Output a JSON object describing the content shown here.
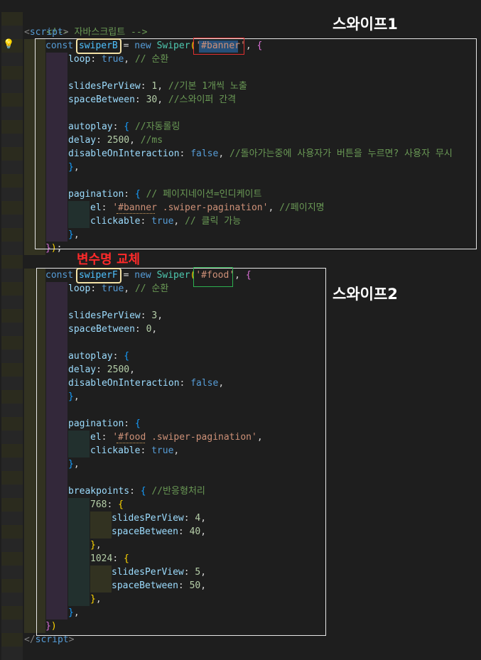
{
  "annotations": {
    "swipe1": "스와이프1",
    "swipe2": "스와이프2",
    "rename": "변수명 교체"
  },
  "code": {
    "l01": {
      "comment": "<!-- 자바스크립트 -->"
    },
    "l02": {
      "open": "<",
      "tag": "script",
      "close": ">"
    },
    "l03": {
      "kw": "const",
      "var": "swiperB",
      "eq": " = ",
      "new": "new",
      "cls": "Swiper",
      "p1": "(",
      "str": "'#banner'",
      "p2": ", ",
      "b": "{"
    },
    "l04": {
      "prop": "loop",
      "colon": ": ",
      "val": "true",
      "comma": ", ",
      "comment": "// 순환"
    },
    "l06": {
      "prop": "slidesPerView",
      "colon": ": ",
      "val": "1",
      "comma": ", ",
      "comment": "//기본 1개씩 노출"
    },
    "l07": {
      "prop": "spaceBetween",
      "colon": ": ",
      "val": "30",
      "comma": ", ",
      "comment": "//스와이퍼 간격"
    },
    "l09": {
      "prop": "autoplay",
      "colon": ": ",
      "b": "{",
      "sp": " ",
      "comment": "//자동롤링"
    },
    "l10": {
      "prop": "delay",
      "colon": ": ",
      "val": "2500",
      "comma": ", ",
      "comment": "//ms"
    },
    "l11": {
      "prop": "disableOnInteraction",
      "colon": ": ",
      "val": "false",
      "comma": ", ",
      "comment": "//돌아가는중에 사용자가 버튼을 누르면? 사용자 무시"
    },
    "l12": {
      "b": "}",
      "comma": ","
    },
    "l14": {
      "prop": "pagination",
      "colon": ": ",
      "b": "{",
      "sp": " ",
      "comment": "// 페이지네이션=인디케이트"
    },
    "l15": {
      "prop": "el",
      "colon": ": ",
      "str": "'#banner .swiper-pagination'",
      "comma": ", ",
      "comment": "//페이지명"
    },
    "l16": {
      "prop": "clickable",
      "colon": ": ",
      "val": "true",
      "comma": ", ",
      "comment": "// 클릭 가능"
    },
    "l17": {
      "b": "}",
      "comma": ","
    },
    "l18": {
      "b": "}",
      "p": ")",
      "semi": ";"
    },
    "l19": {
      "kw": "const",
      "var": "swiperF",
      "eq": " = ",
      "new": "new",
      "cls": "Swiper",
      "p1": "(",
      "str": "'#food'",
      "p2": ", ",
      "b": "{"
    },
    "l20": {
      "prop": "loop",
      "colon": ": ",
      "val": "true",
      "comma": ", ",
      "comment": "// 순환"
    },
    "l22": {
      "prop": "slidesPerView",
      "colon": ": ",
      "val": "3",
      "comma": ","
    },
    "l23": {
      "prop": "spaceBetween",
      "colon": ": ",
      "val": "0",
      "comma": ","
    },
    "l25": {
      "prop": "autoplay",
      "colon": ": ",
      "b": "{"
    },
    "l26": {
      "prop": "delay",
      "colon": ": ",
      "val": "2500",
      "comma": ","
    },
    "l27": {
      "prop": "disableOnInteraction",
      "colon": ": ",
      "val": "false",
      "comma": ","
    },
    "l28": {
      "b": "}",
      "comma": ","
    },
    "l30": {
      "prop": "pagination",
      "colon": ": ",
      "b": "{"
    },
    "l31": {
      "prop": "el",
      "colon": ": ",
      "str": "'#food .swiper-pagination'",
      "comma": ","
    },
    "l32": {
      "prop": "clickable",
      "colon": ": ",
      "val": "true",
      "comma": ","
    },
    "l33": {
      "b": "}",
      "comma": ","
    },
    "l35": {
      "prop": "breakpoints",
      "colon": ": ",
      "b": "{",
      "sp": " ",
      "comment": "//반응형처리"
    },
    "l36": {
      "num": "768",
      "colon": ": ",
      "b": "{"
    },
    "l37": {
      "prop": "slidesPerView",
      "colon": ": ",
      "val": "4",
      "comma": ","
    },
    "l38": {
      "prop": "spaceBetween",
      "colon": ": ",
      "val": "40",
      "comma": ","
    },
    "l39": {
      "b": "}",
      "comma": ","
    },
    "l40": {
      "num": "1024",
      "colon": ": ",
      "b": "{"
    },
    "l41": {
      "prop": "slidesPerView",
      "colon": ": ",
      "val": "5",
      "comma": ","
    },
    "l42": {
      "prop": "spaceBetween",
      "colon": ": ",
      "val": "50",
      "comma": ","
    },
    "l43": {
      "b": "}",
      "comma": ","
    },
    "l44": {
      "b": "}",
      "comma": ","
    },
    "l45": {
      "b": "}",
      "p": ")"
    },
    "l46": {
      "open": "</",
      "tag": "script",
      "close": ">"
    }
  },
  "colors": {
    "background": "#1e1e1e",
    "annotation_text": "#ffffff",
    "annotation_red": "#ff2a2a",
    "annotation_box": "#e6e6e6",
    "highlight_box": "#f3e2a6"
  },
  "icons": {
    "gutter": "lightbulb-icon"
  }
}
